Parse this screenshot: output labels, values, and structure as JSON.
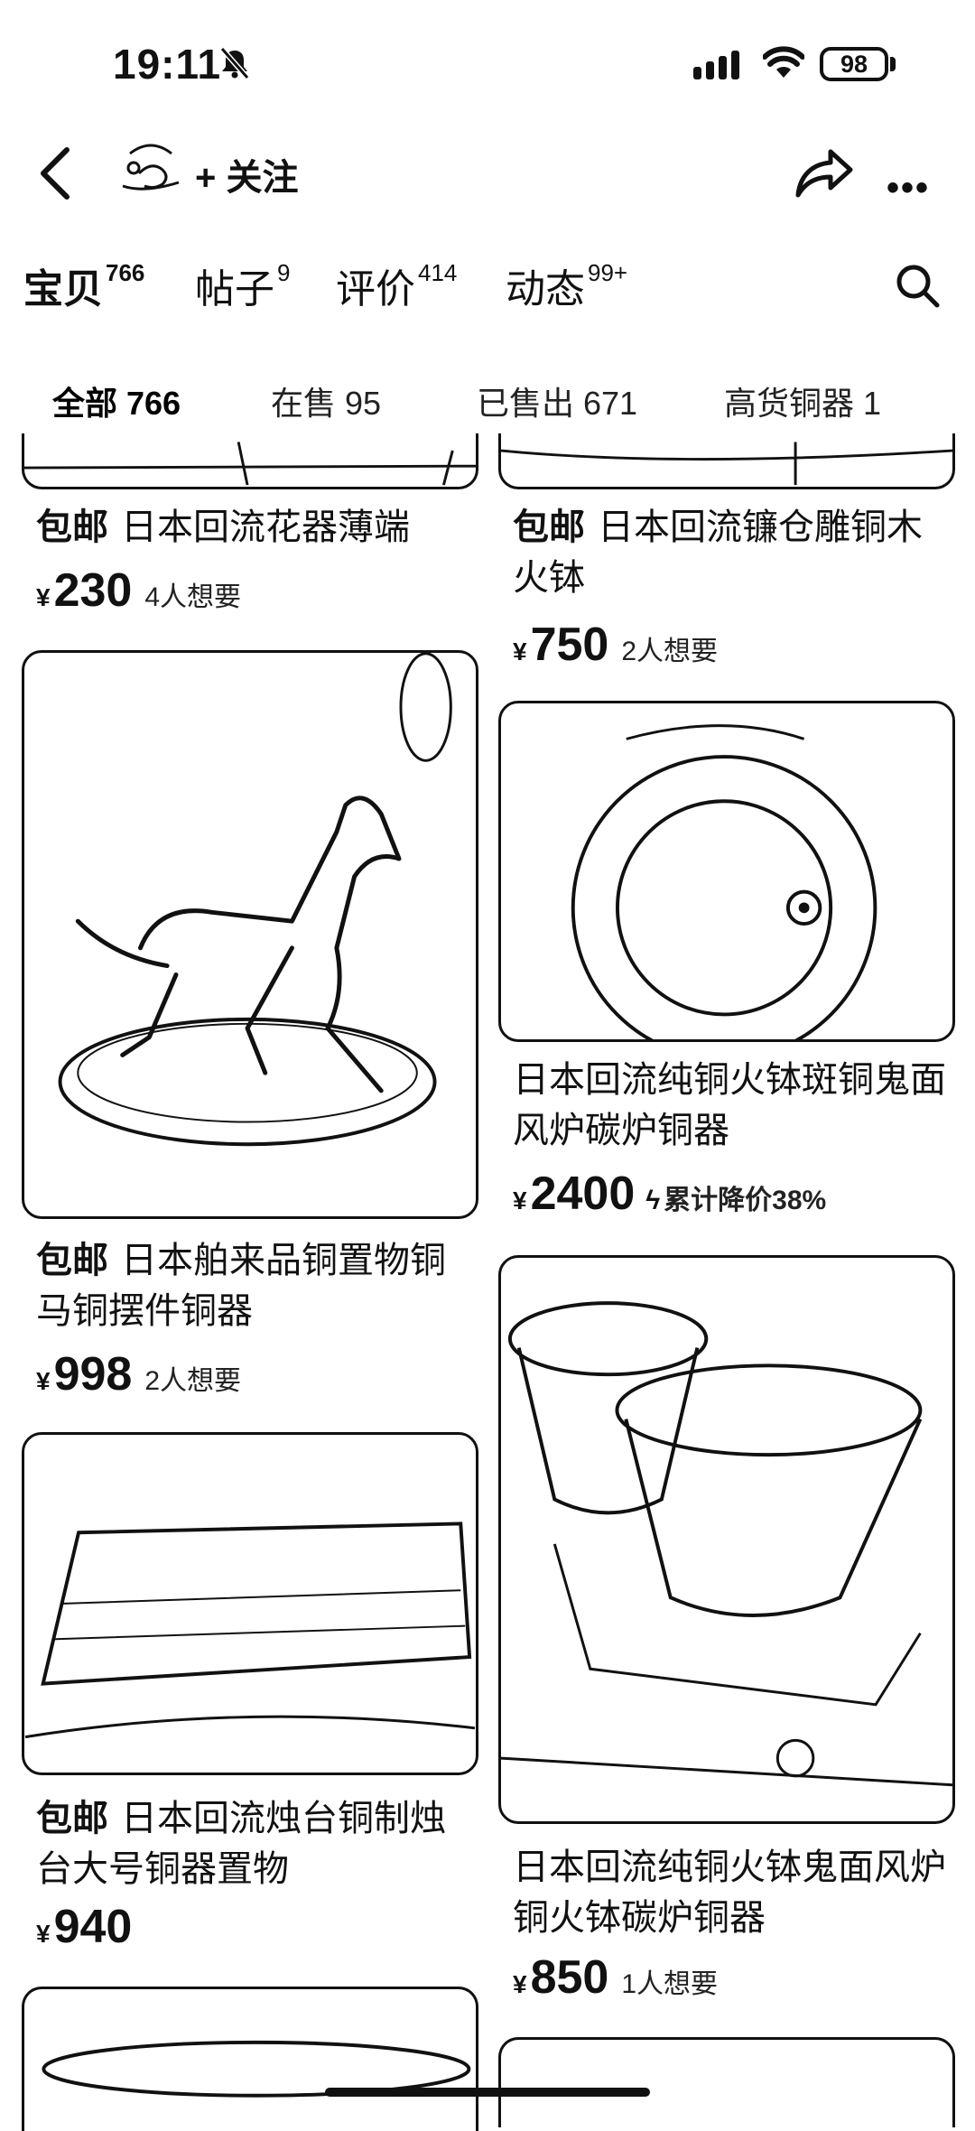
{
  "status": {
    "time": "19:11",
    "battery": "98"
  },
  "nav": {
    "follow_label": "+ 关注",
    "more_label": "•••"
  },
  "tabs": [
    {
      "label": "宝贝",
      "count": "766"
    },
    {
      "label": "帖子",
      "count": "9"
    },
    {
      "label": "评价",
      "count": "414"
    },
    {
      "label": "动态",
      "count": "99+"
    }
  ],
  "subtabs": [
    "全部 766",
    "在售 95",
    "已售出 671",
    "高货铜器 1"
  ],
  "items": [
    {
      "tag": "包邮",
      "title": "日本回流花器薄端",
      "price": "230",
      "note": "4人想要"
    },
    {
      "tag": "包邮",
      "title": "日本回流镰仓雕铜木火钵",
      "price": "750",
      "note": "2人想要"
    },
    {
      "tag": "包邮",
      "title": "日本舶来品铜置物铜马铜摆件铜器",
      "price": "998",
      "note": "2人想要"
    },
    {
      "tag": "",
      "title": "日本回流纯铜火钵斑铜鬼面风炉碳炉铜器",
      "price": "2400",
      "note": "累计降价38%"
    },
    {
      "tag": "包邮",
      "title": "日本回流烛台铜制烛台大号铜器置物",
      "price": "940",
      "note": ""
    },
    {
      "tag": "",
      "title": "日本回流纯铜火钵鬼面风炉铜火钵碳炉铜器",
      "price": "850",
      "note": "1人想要"
    }
  ],
  "currency": "¥",
  "icons": [
    "mute-bell-icon",
    "signal-icon",
    "wifi-icon",
    "back-icon",
    "share-icon",
    "search-icon",
    "bolt-icon"
  ]
}
